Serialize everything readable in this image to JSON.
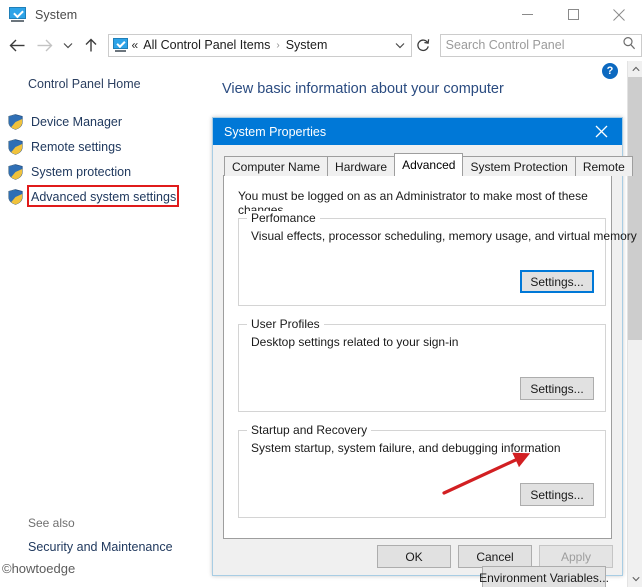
{
  "window": {
    "title": "System",
    "icon": "system-monitor-icon",
    "controls": {
      "minimize": "minimize-icon",
      "maximize": "maximize-icon",
      "close": "close-icon"
    }
  },
  "navbar": {
    "back": "back-arrow-icon",
    "forward": "forward-arrow-icon",
    "recent": "chevron-down-icon",
    "up": "up-arrow-icon",
    "address": {
      "icon": "control-panel-icon",
      "overflow": "«",
      "crumbs": [
        "All Control Panel Items",
        "System"
      ],
      "separator": "›",
      "dropdown": "chevron-down-icon"
    },
    "refresh": "refresh-icon",
    "search": {
      "placeholder": "Search Control Panel",
      "value": "",
      "icon": "search-icon"
    }
  },
  "sidebar": {
    "home_label": "Control Panel Home",
    "items": [
      {
        "label": "Device Manager",
        "icon": "shield-icon",
        "highlighted": false
      },
      {
        "label": "Remote settings",
        "icon": "shield-icon",
        "highlighted": false
      },
      {
        "label": "System protection",
        "icon": "shield-icon",
        "highlighted": false
      },
      {
        "label": "Advanced system settings",
        "icon": "shield-icon",
        "highlighted": true
      }
    ],
    "see_also_label": "See also",
    "see_also_links": [
      "Security and Maintenance"
    ],
    "watermark": "©howtoedge"
  },
  "main": {
    "heading": "View basic information about your computer",
    "help_icon": "help-icon",
    "help_glyph": "?"
  },
  "scrollbar": {
    "up": "scroll-up-icon",
    "down": "scroll-down-icon",
    "thumb": "scroll-thumb"
  },
  "dialog": {
    "title": "System Properties",
    "close_icon": "close-icon",
    "tabs": [
      {
        "label": "Computer Name",
        "active": false
      },
      {
        "label": "Hardware",
        "active": false
      },
      {
        "label": "Advanced",
        "active": true
      },
      {
        "label": "System Protection",
        "active": false
      },
      {
        "label": "Remote",
        "active": false
      }
    ],
    "admin_note": "You must be logged on as an Administrator to make most of these changes.",
    "groups": [
      {
        "legend": "Perfomance",
        "description": "Visual effects, processor scheduling, memory usage, and virtual memory",
        "button_label": "Settings...",
        "button_focused": true
      },
      {
        "legend": "User Profiles",
        "description": "Desktop settings related to your sign-in",
        "button_label": "Settings...",
        "button_focused": false
      },
      {
        "legend": "Startup and Recovery",
        "description": "System startup, system failure, and debugging information",
        "button_label": "Settings...",
        "button_focused": false
      }
    ],
    "environment_button": "Environment Variables...",
    "footer": {
      "ok": "OK",
      "cancel": "Cancel",
      "apply": "Apply",
      "apply_disabled": true
    }
  },
  "annotations": {
    "red_box_target": "Advanced system settings",
    "red_box_color": "#e01b1b",
    "red_arrow_color": "#d21f22",
    "red_arrow_target": "startup-recovery-settings-button"
  },
  "colors": {
    "accent": "#0078d7",
    "dialog_bg": "#f0f0f0",
    "link": "#20395e",
    "heading": "#2a4b80"
  }
}
